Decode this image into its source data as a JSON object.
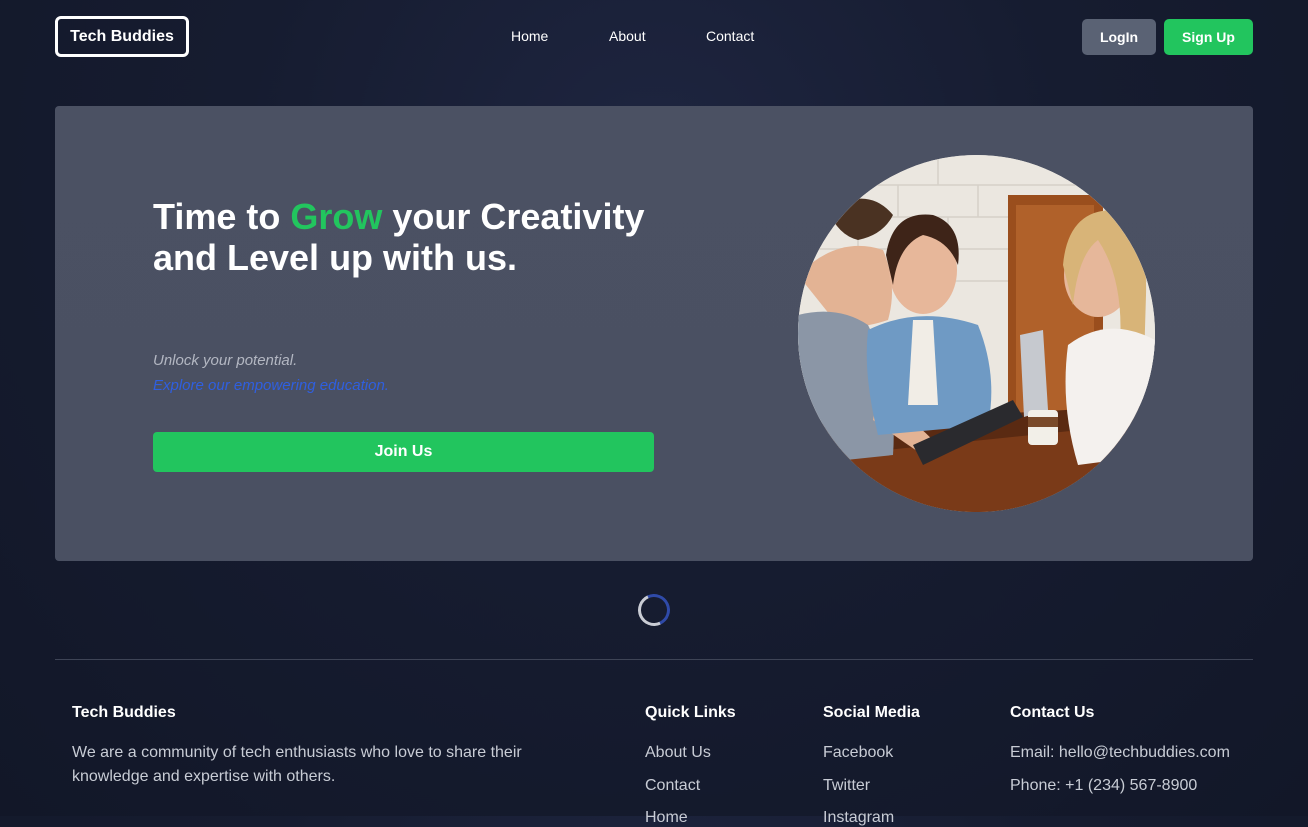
{
  "header": {
    "logo": "Tech Buddies",
    "nav": [
      "Home",
      "About",
      "Contact"
    ],
    "login": "LogIn",
    "signup": "Sign Up"
  },
  "hero": {
    "title_part1": "Time to ",
    "title_accent": "Grow",
    "title_part2": " your Creativity and Level up with us.",
    "tagline1": "Unlock your potential.",
    "tagline2": "Explore our empowering education.",
    "cta": "Join Us",
    "image_alt": "Three friends smiling around a laptop and tablet at a cafe table"
  },
  "footer": {
    "brand_title": "Tech Buddies",
    "brand_desc_line1": "We are a community of tech enthusiasts who love to share their",
    "brand_desc_line2": "knowledge and expertise with others.",
    "quick_links_title": "Quick Links",
    "quick_links": [
      "About Us",
      "Contact",
      "Home"
    ],
    "social_title": "Social Media",
    "social": [
      "Facebook",
      "Twitter",
      "Instagram"
    ],
    "contact_title": "Contact Us",
    "email": "Email: hello@techbuddies.com",
    "phone": "Phone: +1 (234) 567-8900"
  },
  "colors": {
    "accent": "#22c55e",
    "link_blue": "#2f5fe0",
    "background": "#161c30",
    "hero_panel": "#4b5163",
    "login_button": "#5a6274"
  }
}
